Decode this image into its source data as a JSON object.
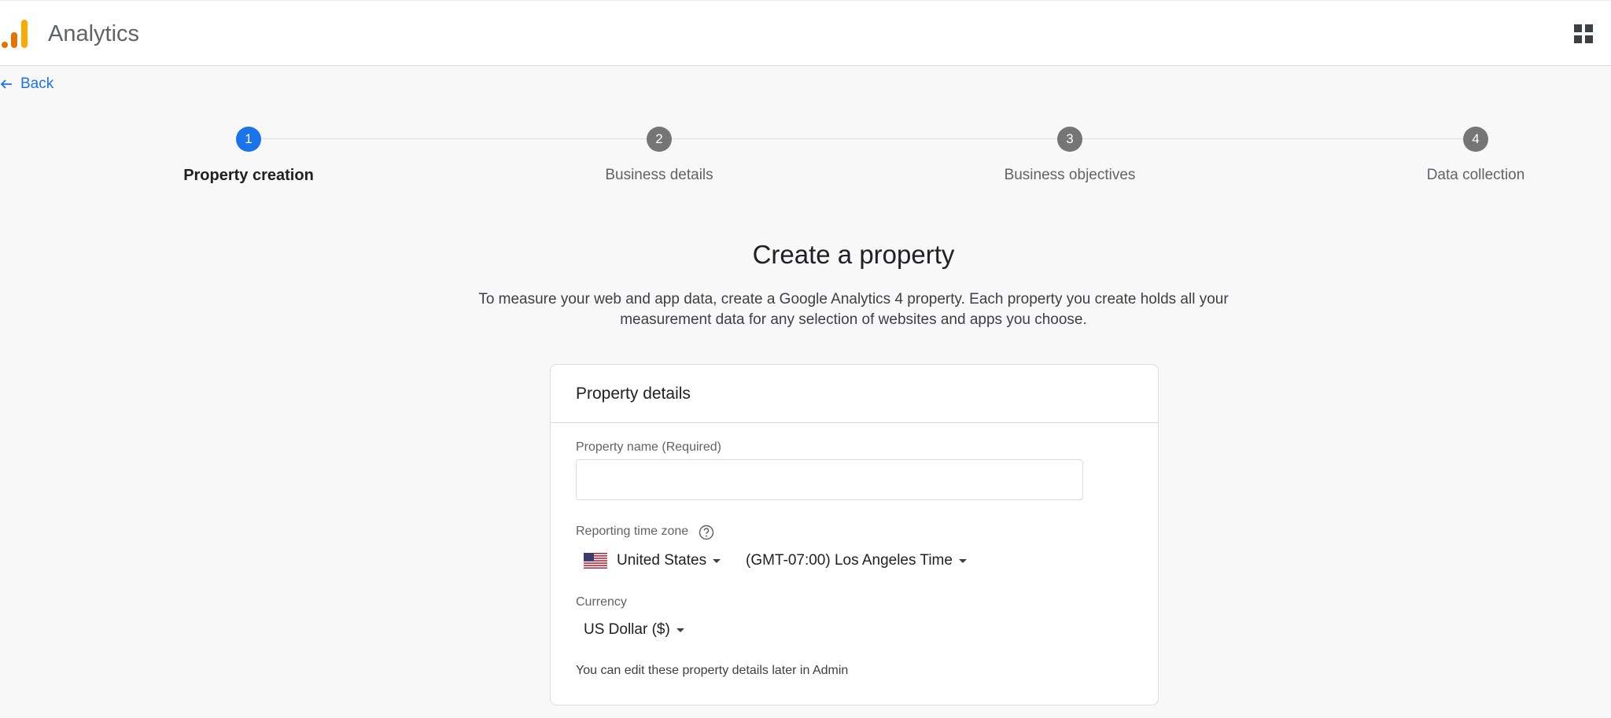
{
  "header": {
    "app_title": "Analytics"
  },
  "nav": {
    "back_label": "Back"
  },
  "stepper": {
    "steps": [
      {
        "number": "1",
        "label": "Property creation",
        "active": true
      },
      {
        "number": "2",
        "label": "Business details",
        "active": false
      },
      {
        "number": "3",
        "label": "Business objectives",
        "active": false
      },
      {
        "number": "4",
        "label": "Data collection",
        "active": false
      }
    ]
  },
  "main": {
    "title": "Create a property",
    "description": "To measure your web and app data, create a Google Analytics 4 property. Each property you create holds all your measurement data for any selection of websites and apps you choose."
  },
  "card": {
    "title": "Property details",
    "property_name_label": "Property name (Required)",
    "property_name_value": "",
    "timezone_label": "Reporting time zone",
    "country": "United States",
    "timezone": "(GMT-07:00) Los Angeles Time",
    "currency_label": "Currency",
    "currency": "US Dollar ($)",
    "note": "You can edit these property details later in Admin"
  },
  "colors": {
    "accent": "#1a73e8",
    "inactive_step": "#757575",
    "logo_dark": "#e37400",
    "logo_light": "#f9ab00"
  }
}
